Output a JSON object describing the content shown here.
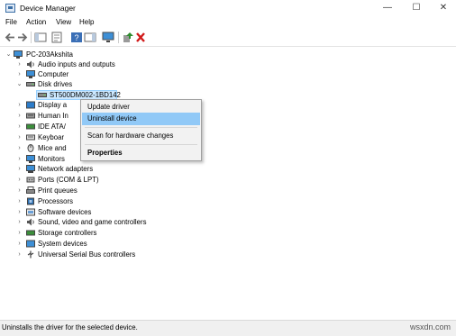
{
  "window": {
    "title": "Device Manager",
    "minimize_glyph": "—",
    "maximize_glyph": "☐",
    "close_glyph": "✕"
  },
  "menu": [
    "File",
    "Action",
    "View",
    "Help"
  ],
  "toolbar_icons": [
    "back-arrow-icon",
    "forward-arrow-icon",
    "show-hide-console-tree-icon",
    "properties-icon",
    "help-icon",
    "action-pane-icon",
    "monitor-icon",
    "update-driver-icon",
    "uninstall-red-x-icon"
  ],
  "tree": {
    "root": "PC-203Akshita",
    "nodes": [
      {
        "label": "Audio inputs and outputs",
        "icon": "speaker-icon",
        "state": "collapsed"
      },
      {
        "label": "Computer",
        "icon": "computer-icon",
        "state": "collapsed"
      },
      {
        "label": "Disk drives",
        "icon": "disk-drive-icon",
        "state": "expanded"
      },
      {
        "label": "ST500DM002-1BD142",
        "icon": "disk-drive-icon",
        "state": "child"
      },
      {
        "label": "Display a",
        "icon": "display-adapter-icon",
        "state": "collapsed"
      },
      {
        "label": "Human In",
        "icon": "hid-icon",
        "state": "collapsed"
      },
      {
        "label": "IDE ATA/",
        "icon": "ide-controller-icon",
        "state": "collapsed"
      },
      {
        "label": "Keyboar",
        "icon": "keyboard-icon",
        "state": "collapsed"
      },
      {
        "label": "Mice and",
        "icon": "mouse-icon",
        "state": "collapsed"
      },
      {
        "label": "Monitors",
        "icon": "monitor-icon",
        "state": "collapsed"
      },
      {
        "label": "Network adapters",
        "icon": "network-adapter-icon",
        "state": "collapsed"
      },
      {
        "label": "Ports (COM & LPT)",
        "icon": "port-icon",
        "state": "collapsed"
      },
      {
        "label": "Print queues",
        "icon": "printer-icon",
        "state": "collapsed"
      },
      {
        "label": "Processors",
        "icon": "processor-icon",
        "state": "collapsed"
      },
      {
        "label": "Software devices",
        "icon": "software-device-icon",
        "state": "collapsed"
      },
      {
        "label": "Sound, video and game controllers",
        "icon": "sound-icon",
        "state": "collapsed"
      },
      {
        "label": "Storage controllers",
        "icon": "storage-controller-icon",
        "state": "collapsed"
      },
      {
        "label": "System devices",
        "icon": "system-device-icon",
        "state": "collapsed"
      },
      {
        "label": "Universal Serial Bus controllers",
        "icon": "usb-icon",
        "state": "collapsed"
      }
    ]
  },
  "context_menu": {
    "items": [
      "Update driver",
      "Uninstall device",
      "Scan for hardware changes",
      "Properties"
    ],
    "highlighted": "Uninstall device"
  },
  "status_bar": {
    "text": "Uninstalls the driver for the selected device.",
    "watermark": "wsxdn.com"
  },
  "colors": {
    "selection": "#cce8ff",
    "menu_highlight": "#91c9f7",
    "uninstall_red": "#d11a1a",
    "update_green": "#2e8b2e"
  }
}
